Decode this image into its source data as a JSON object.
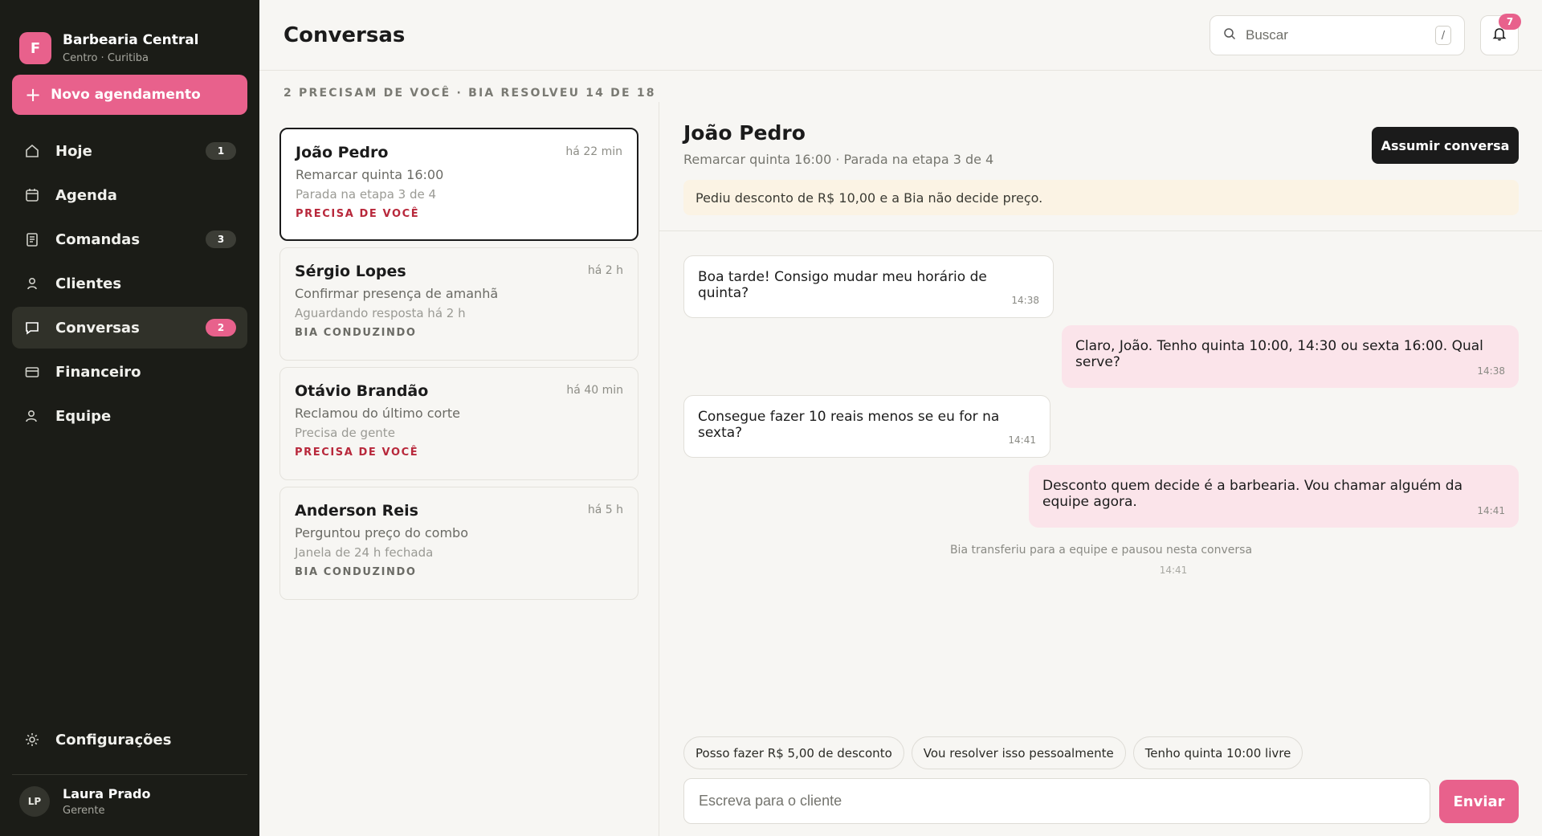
{
  "brand": {
    "initial": "F",
    "name": "Barbearia Central",
    "location": "Centro · Curitiba"
  },
  "new_button": {
    "label": "Novo agendamento",
    "icon": "plus-icon"
  },
  "nav": {
    "items": [
      {
        "label": "Hoje",
        "icon": "home-icon",
        "badge": "1"
      },
      {
        "label": "Agenda",
        "icon": "calendar-icon",
        "badge": ""
      },
      {
        "label": "Comandas",
        "icon": "receipt-icon",
        "badge": "3"
      },
      {
        "label": "Clientes",
        "icon": "person-icon",
        "badge": ""
      },
      {
        "label": "Conversas",
        "icon": "chat-icon",
        "badge": "2",
        "active": true
      },
      {
        "label": "Financeiro",
        "icon": "card-icon",
        "badge": ""
      },
      {
        "label": "Equipe",
        "icon": "team-icon",
        "badge": ""
      }
    ],
    "settings_label": "Configurações"
  },
  "user": {
    "initials": "LP",
    "name": "Laura Prado",
    "role": "Gerente"
  },
  "header": {
    "title": "Conversas",
    "search_placeholder": "Buscar",
    "search_shortcut": "/",
    "notifications_count": "7"
  },
  "summary": "2 PRECISAM DE VOCÊ · BIA RESOLVEU 14 DE 18",
  "conversations": [
    {
      "name": "João Pedro",
      "time": "há 22 min",
      "subject": "Remarcar quinta 16:00",
      "meta": "Parada na etapa 3 de 4",
      "status": "PRECISA DE VOCÊ",
      "urgent": true,
      "selected": true
    },
    {
      "name": "Sérgio Lopes",
      "time": "há 2 h",
      "subject": "Confirmar presença de amanhã",
      "meta": "Aguardando resposta há 2 h",
      "status": "BIA CONDUZINDO",
      "urgent": false
    },
    {
      "name": "Otávio Brandão",
      "time": "há 40 min",
      "subject": "Reclamou do último corte",
      "meta": "Precisa de gente",
      "status": "PRECISA DE VOCÊ",
      "urgent": true
    },
    {
      "name": "Anderson Reis",
      "time": "há 5 h",
      "subject": "Perguntou preço do combo",
      "meta": "Janela de 24 h fechada",
      "status": "BIA CONDUZINDO",
      "urgent": false
    }
  ],
  "chat": {
    "name": "João Pedro",
    "subtitle": "Remarcar quinta 16:00 · Parada na etapa 3 de 4",
    "assume_label": "Assumir conversa",
    "alert": "Pediu desconto de R$ 10,00 e a Bia não decide preço.",
    "messages": [
      {
        "dir": "in",
        "text": "Boa tarde! Consigo mudar meu horário de quinta?",
        "time": "14:38"
      },
      {
        "dir": "out",
        "text": "Claro, João. Tenho quinta 10:00, 14:30 ou sexta 16:00. Qual serve?",
        "time": "14:38"
      },
      {
        "dir": "in",
        "text": "Consegue fazer 10 reais menos se eu for na sexta?",
        "time": "14:41"
      },
      {
        "dir": "out",
        "text": "Desconto quem decide é a barbearia. Vou chamar alguém da equipe agora.",
        "time": "14:41"
      }
    ],
    "system_note": {
      "text": "Bia transferiu para a equipe e pausou nesta conversa",
      "time": "14:41"
    },
    "quick_replies": [
      "Posso fazer R$ 5,00 de desconto",
      "Vou resolver isso pessoalmente",
      "Tenho quinta 10:00 livre"
    ],
    "composer_placeholder": "Escreva para o cliente",
    "send_label": "Enviar"
  },
  "colors": {
    "accent": "#e8618c",
    "sidebar": "#1b1c17",
    "urgent": "#b8283b",
    "alert_bg": "#fbf3e4",
    "outgoing_bubble": "#fbe4ea"
  }
}
